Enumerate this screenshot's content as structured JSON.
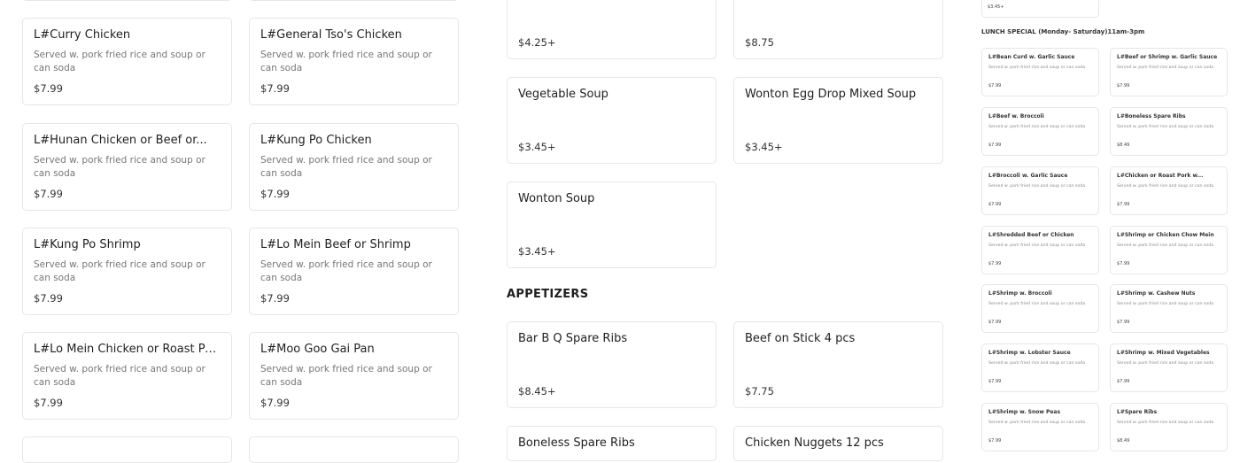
{
  "desc": "Served w. pork fried rice and soup or can soda",
  "left": [
    {
      "title": "L#Curry Chicken",
      "price": "$7.99"
    },
    {
      "title": "L#General Tso's Chicken",
      "price": "$7.99"
    },
    {
      "title": "L#Hunan Chicken or Beef or...",
      "price": "$7.99"
    },
    {
      "title": "L#Kung Po Chicken",
      "price": "$7.99"
    },
    {
      "title": "L#Kung Po Shrimp",
      "price": "$7.99"
    },
    {
      "title": "L#Lo Mein Beef or Shrimp",
      "price": "$7.99"
    },
    {
      "title": "L#Lo Mein Chicken or Roast Pork",
      "price": "$7.99"
    },
    {
      "title": "L#Moo Goo Gai Pan",
      "price": "$7.99"
    }
  ],
  "middle": {
    "top_prices": [
      "$4.25+",
      "$8.75"
    ],
    "soups": [
      {
        "title": "Vegetable Soup",
        "price": "$3.45+"
      },
      {
        "title": "Wonton Egg Drop Mixed Soup",
        "price": "$3.45+"
      },
      {
        "title": "Wonton Soup",
        "price": "$3.45+"
      }
    ],
    "appetizers_heading": "APPETIZERS",
    "appetizers": [
      {
        "title": "Bar B Q Spare Ribs",
        "price": "$8.45+"
      },
      {
        "title": "Beef on Stick 4 pcs",
        "price": "$7.75"
      },
      {
        "title": "Boneless Spare Ribs",
        "price": ""
      },
      {
        "title": "Chicken Nuggets 12 pcs",
        "price": ""
      }
    ]
  },
  "right": {
    "top_price": "$3.45+",
    "lunch_heading": "LUNCH SPECIAL (Monday- Saturday)11am-3pm",
    "items": [
      {
        "title": "L#Bean Curd w. Garlic Sauce",
        "price": "$7.99"
      },
      {
        "title": "L#Beef or Shrimp w. Garlic Sauce",
        "price": "$7.99"
      },
      {
        "title": "L#Beef w. Broccoli",
        "price": "$7.99"
      },
      {
        "title": "L#Boneless Spare Ribs",
        "price": "$8.49"
      },
      {
        "title": "L#Broccoli w. Garlic Sauce",
        "price": "$7.99"
      },
      {
        "title": "L#Chicken or Roast Pork w...",
        "price": "$7.99"
      },
      {
        "title": "L#Shredded Beef or Chicken",
        "price": "$7.99"
      },
      {
        "title": "L#Shrimp or Chicken Chow Mein",
        "price": "$7.99"
      },
      {
        "title": "L#Shrimp w. Broccoli",
        "price": "$7.99"
      },
      {
        "title": "L#Shrimp w. Cashew Nuts",
        "price": "$7.99"
      },
      {
        "title": "L#Shrimp w. Lobster Sauce",
        "price": "$7.99"
      },
      {
        "title": "L#Shrimp w. Mixed Vegetables",
        "price": "$7.99"
      },
      {
        "title": "L#Shrimp w. Snow Peas",
        "price": "$7.99"
      },
      {
        "title": "L#Spare Ribs",
        "price": "$8.49"
      }
    ]
  }
}
